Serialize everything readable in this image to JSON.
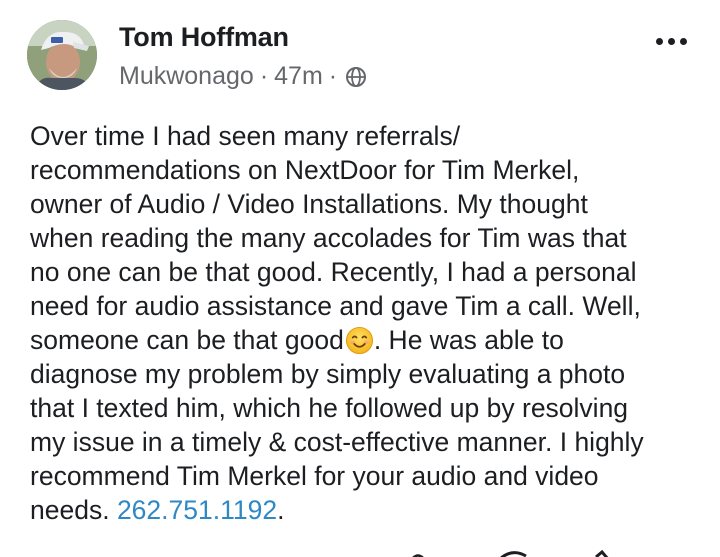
{
  "post": {
    "author": {
      "name": "Tom Hoffman",
      "location": "Mukwonago",
      "time": "47m",
      "separator": "·",
      "audience_icon": "globe-icon",
      "avatar_icon": "avatar-photo"
    },
    "menu_icon": "more-options-icon",
    "body": {
      "line_1": "Over time I had seen many referrals/",
      "line_2": "recommendations on NextDoor for Tim Merkel,",
      "line_3": "owner of Audio / Video Installations.  My thought",
      "line_4": "when reading the many accolades for Tim was that",
      "line_5": "no one can be that good.  Recently, I had a personal",
      "line_6": "need for audio assistance and gave Tim a call.  Well,",
      "line_7_before_emoji": "someone can be that good",
      "emoji": "smiling-face-emoji",
      "line_7_after_emoji": ".  He was able to",
      "line_8": "diagnose my problem by simply evaluating a photo",
      "line_9": "that I texted him, which he followed up by resolving",
      "line_10": "my issue in a timely & cost-effective manner.  I highly",
      "line_11": "recommend Tim Merkel for your audio and video",
      "line_12_before_link": "needs. ",
      "phone_link": "262.751.1192",
      "line_12_after_link": "."
    }
  },
  "colors": {
    "text": "#1c1e21",
    "meta": "#65676b",
    "link": "#2d88c5",
    "background": "#ffffff"
  }
}
